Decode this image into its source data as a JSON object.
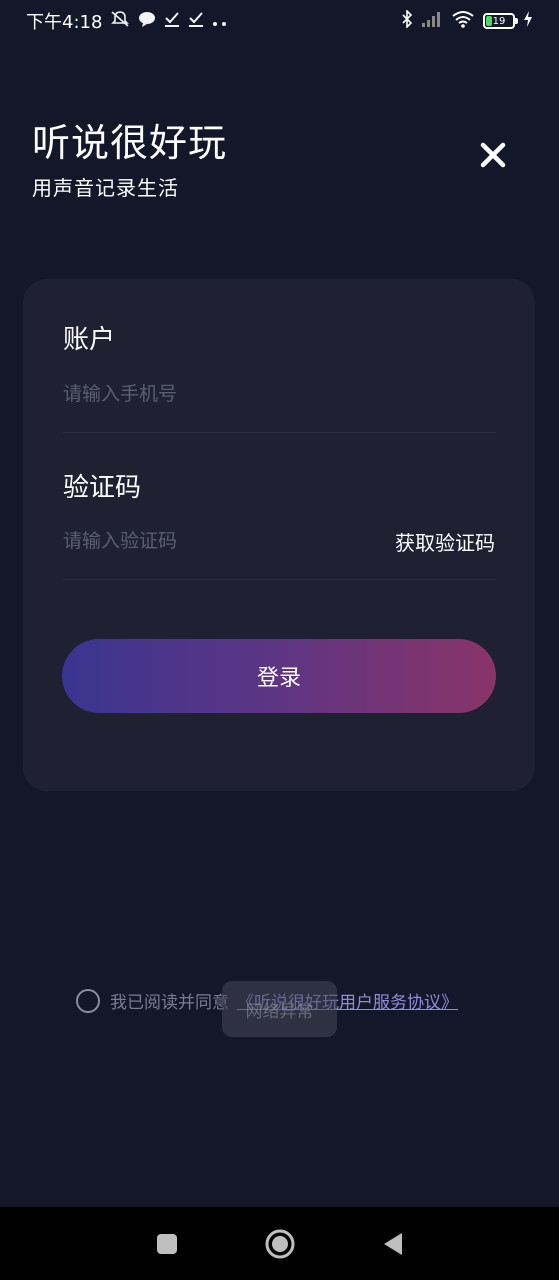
{
  "status_bar": {
    "time": "下午4:18",
    "left_icons": [
      "mute-icon",
      "chat-icon",
      "check-icon",
      "check-icon",
      "more-dots-icon"
    ],
    "right_icons": [
      "bluetooth-icon",
      "signal-icon",
      "wifi-icon"
    ],
    "battery_level": "19"
  },
  "header": {
    "title": "听说很好玩",
    "subtitle": "用声音记录生活",
    "close_icon": "close-icon"
  },
  "form": {
    "account_label": "账户",
    "account_placeholder": "请输入手机号",
    "code_label": "验证码",
    "code_placeholder": "请输入验证码",
    "get_code_label": "获取验证码",
    "login_label": "登录"
  },
  "agreement": {
    "checked": false,
    "text": "我已阅读并同意",
    "link": "《听说很好玩用户服务协议》"
  },
  "toast": {
    "text": "网络异常"
  },
  "nav_bar": {
    "buttons": [
      "recents-icon",
      "home-icon",
      "back-icon"
    ]
  },
  "colors": {
    "background": "#14162a",
    "card": "#1f2133",
    "gradient_start": "#3a3590",
    "gradient_end": "#8a3468",
    "link": "#8c8fd6"
  }
}
